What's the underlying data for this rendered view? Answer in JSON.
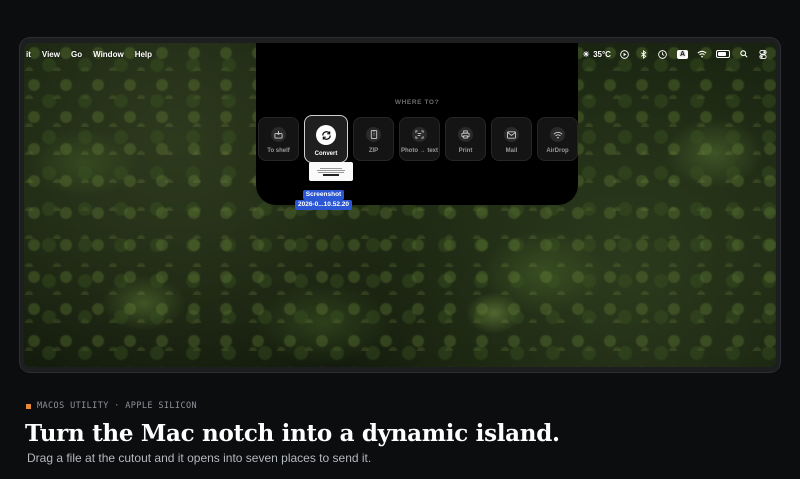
{
  "menubar": {
    "left_items": [
      "it",
      "View",
      "Go",
      "Window",
      "Help"
    ],
    "weather": "35°C",
    "keyboard_badge": "A",
    "icons": [
      "sun-icon",
      "play-icon",
      "bluetooth-icon",
      "clock-icon",
      "keyboard-badge",
      "wifi-icon",
      "battery-icon",
      "search-icon",
      "control-center-icon"
    ]
  },
  "island": {
    "heading": "WHERE TO?",
    "destinations": [
      {
        "label": "To shelf",
        "icon": "shelf-icon",
        "active": false
      },
      {
        "label": "Convert",
        "icon": "convert-icon",
        "active": true
      },
      {
        "label": "ZIP",
        "icon": "zip-icon",
        "active": false
      },
      {
        "label": "Photo → text",
        "icon": "scan-text-icon",
        "active": false
      },
      {
        "label": "Print",
        "icon": "print-icon",
        "active": false
      },
      {
        "label": "Mail",
        "icon": "mail-icon",
        "active": false
      },
      {
        "label": "AirDrop",
        "icon": "airdrop-icon",
        "active": false
      }
    ]
  },
  "dragged_file": {
    "name_line1": "Screenshot",
    "name_line2": "2026-0...10.52.20"
  },
  "hero": {
    "tagline": "MACOS UTILITY · APPLE SILICON",
    "headline": "Turn the Mac notch into a dynamic island.",
    "subline": "Drag a file at the cutout and it opens into seven places to send it."
  },
  "colors": {
    "accent": "#e8893a",
    "selection": "#2b56d4",
    "background": "#0c0d0f"
  }
}
